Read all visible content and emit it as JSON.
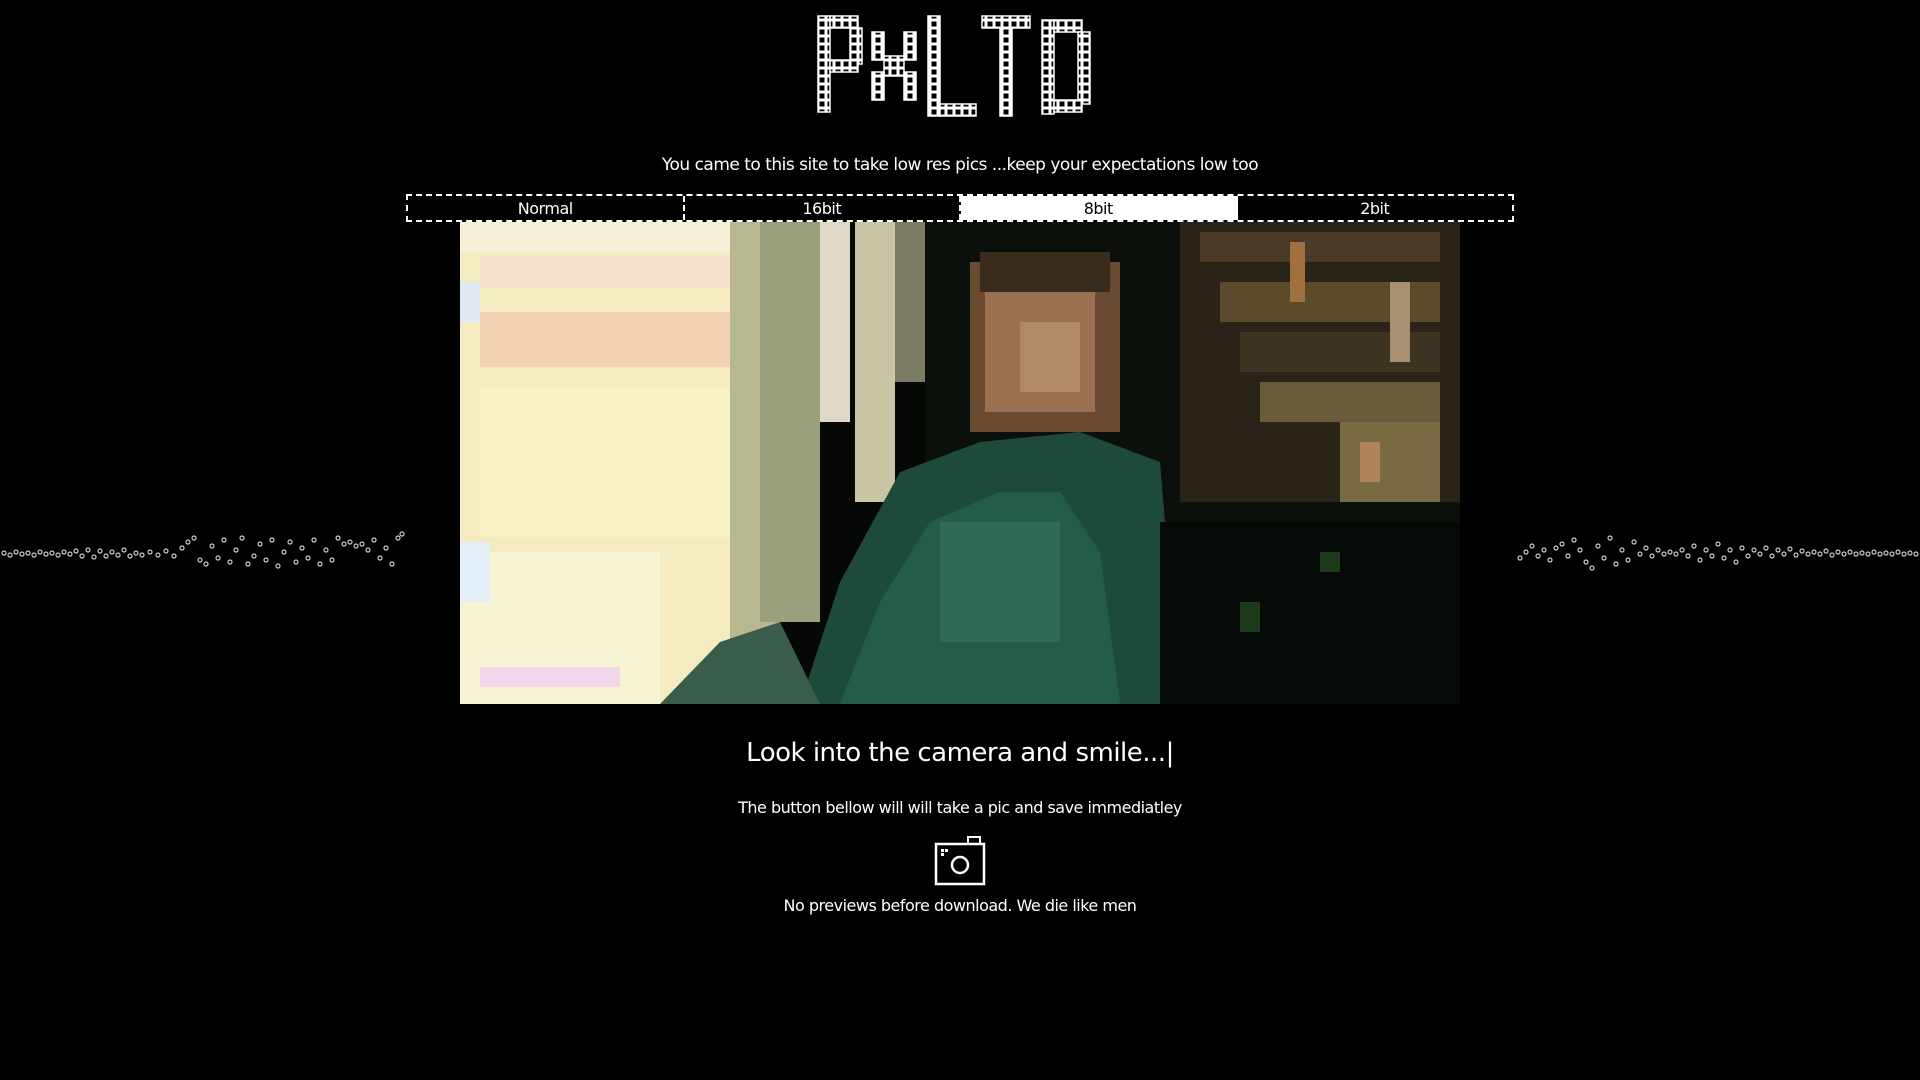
{
  "logo": {
    "text": "PXLTD"
  },
  "tagline": "You came to this site to take low res pics ...keep your expectations low too",
  "modes": [
    {
      "label": "Normal",
      "active": false
    },
    {
      "label": "16bit",
      "active": false
    },
    {
      "label": "8bit",
      "active": true
    },
    {
      "label": "2bit",
      "active": false
    }
  ],
  "headline": "Look into the camera and smile...|",
  "subtext": "The button bellow will will take a pic and save immediatley",
  "capture_button": {
    "icon": "camera-icon"
  },
  "footnote": "No previews before download. We die like men",
  "colors": {
    "background": "#000000",
    "foreground": "#ffffff"
  }
}
